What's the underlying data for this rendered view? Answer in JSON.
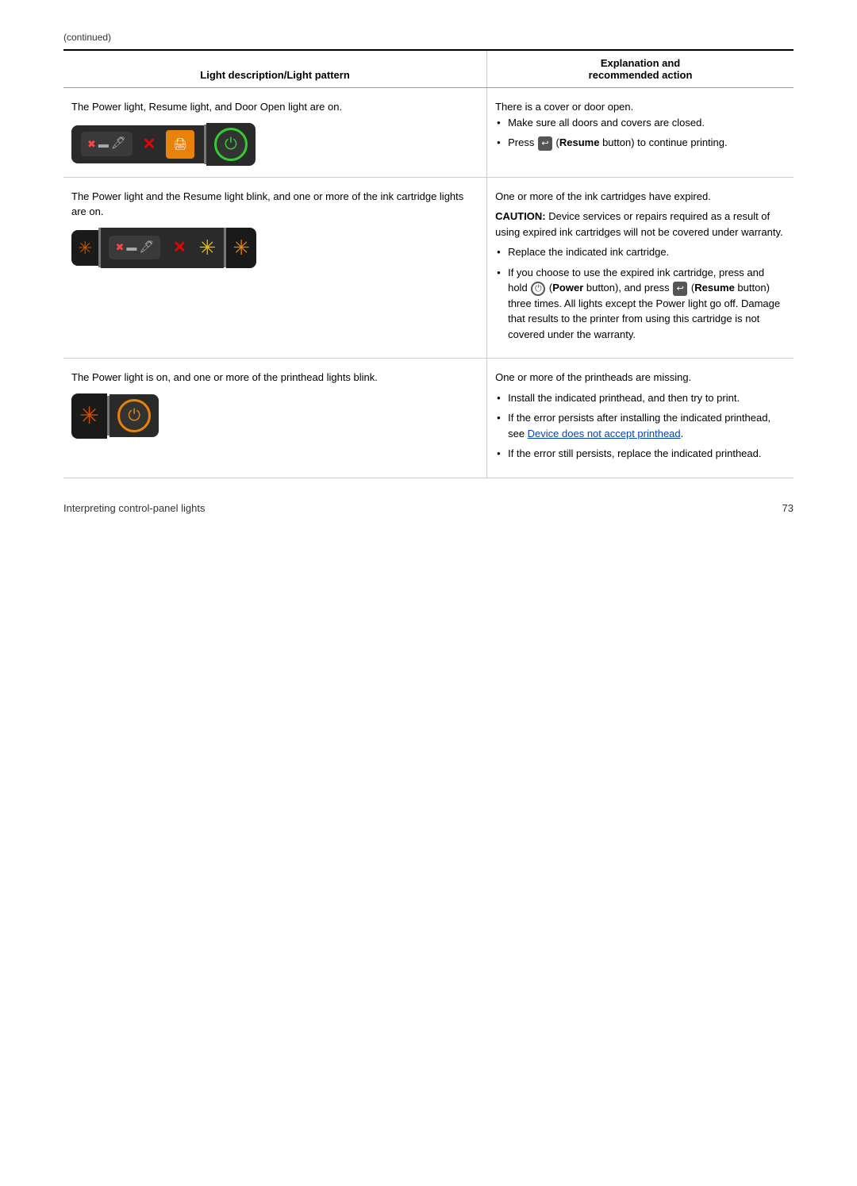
{
  "page": {
    "continued_label": "(continued)",
    "footer_text": "Interpreting control-panel lights",
    "footer_page": "73"
  },
  "table": {
    "header": {
      "col1": "Light description/Light pattern",
      "col2_line1": "Explanation and",
      "col2_line2": "recommended action"
    },
    "rows": [
      {
        "id": "row1",
        "description": "The Power light, Resume light, and Door Open light are on.",
        "explanation": "There is a cover or door open.",
        "actions": [
          "Make sure all doors and covers are closed.",
          "Press [Resume] (Resume button) to continue printing."
        ]
      },
      {
        "id": "row2",
        "description": "The Power light and the Resume light blink, and one or more of the ink cartridge lights are on.",
        "caution_label": "CAUTION:",
        "caution_text": "Device services or repairs required as a result of using expired ink cartridges will not be covered under warranty.",
        "explanation": "One or more of the ink cartridges have expired.",
        "actions": [
          "Replace the indicated ink cartridge.",
          "If you choose to use the expired ink cartridge, press and hold [Power] (Power button), and press [Resume] (Resume button) three times. All lights except the Power light go off. Damage that results to the printer from using this cartridge is not covered under the warranty."
        ]
      },
      {
        "id": "row3",
        "description": "The Power light is on, and one or more of the printhead lights blink.",
        "explanation": "One or more of the printheads are missing.",
        "actions": [
          "Install the indicated printhead, and then try to print.",
          "If the error persists after installing the indicated printhead, see Device does not accept printhead.",
          "If the error still persists, replace the indicated printhead."
        ],
        "link_text": "Device does not accept printhead"
      }
    ]
  }
}
